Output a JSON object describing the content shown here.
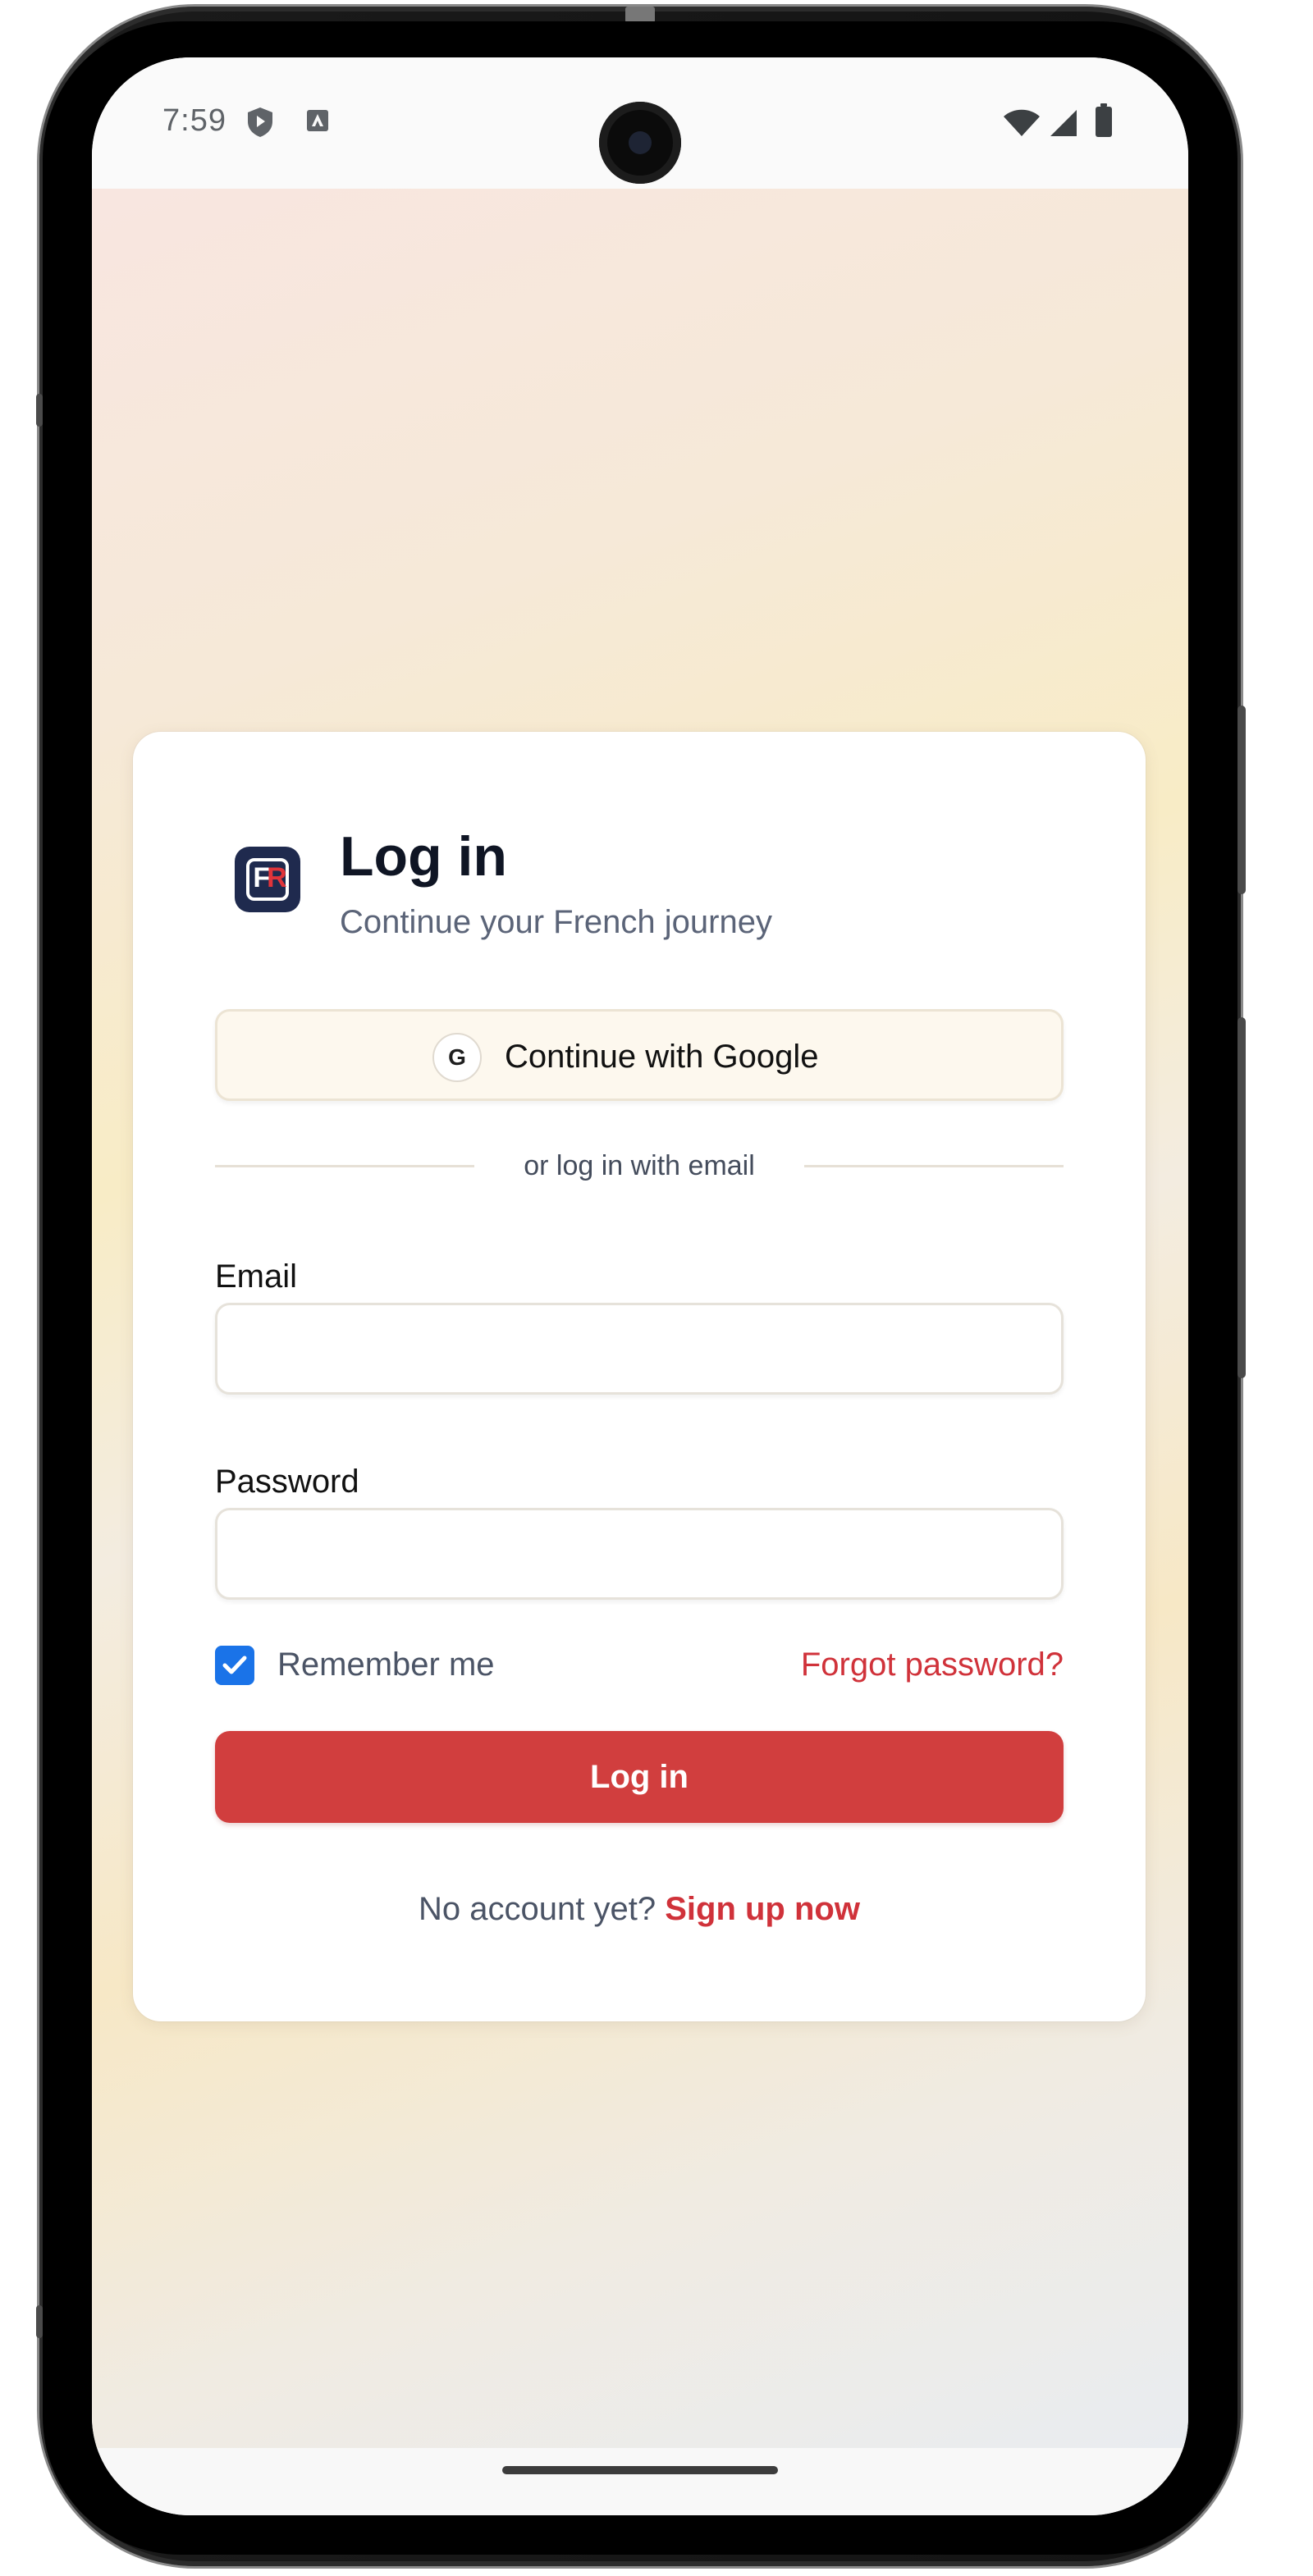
{
  "status_bar": {
    "time": "7:59",
    "left_icons": [
      "shield-icon",
      "app-notification-icon"
    ],
    "right_icons": [
      "wifi-icon",
      "signal-icon",
      "battery-icon"
    ]
  },
  "login": {
    "brand": {
      "letter_primary": "F",
      "letter_accent": "R",
      "primary_color": "#1f2a4e",
      "accent_color": "#e0343a"
    },
    "title": "Log in",
    "subtitle": "Continue your French journey",
    "google_button": {
      "icon_letter": "G",
      "label": "Continue with Google"
    },
    "divider_text": "or log in with email",
    "email": {
      "label": "Email",
      "value": "",
      "placeholder": ""
    },
    "password": {
      "label": "Password",
      "value": "",
      "placeholder": ""
    },
    "remember_me": {
      "label": "Remember me",
      "checked": true
    },
    "forgot_password": "Forgot password?",
    "submit_label": "Log in",
    "signup_prompt": "No account yet?",
    "signup_link": "Sign up now"
  },
  "colors": {
    "accent_red": "#d13e3e",
    "link_red": "#d0323a",
    "checkbox_blue": "#1a73e8"
  }
}
